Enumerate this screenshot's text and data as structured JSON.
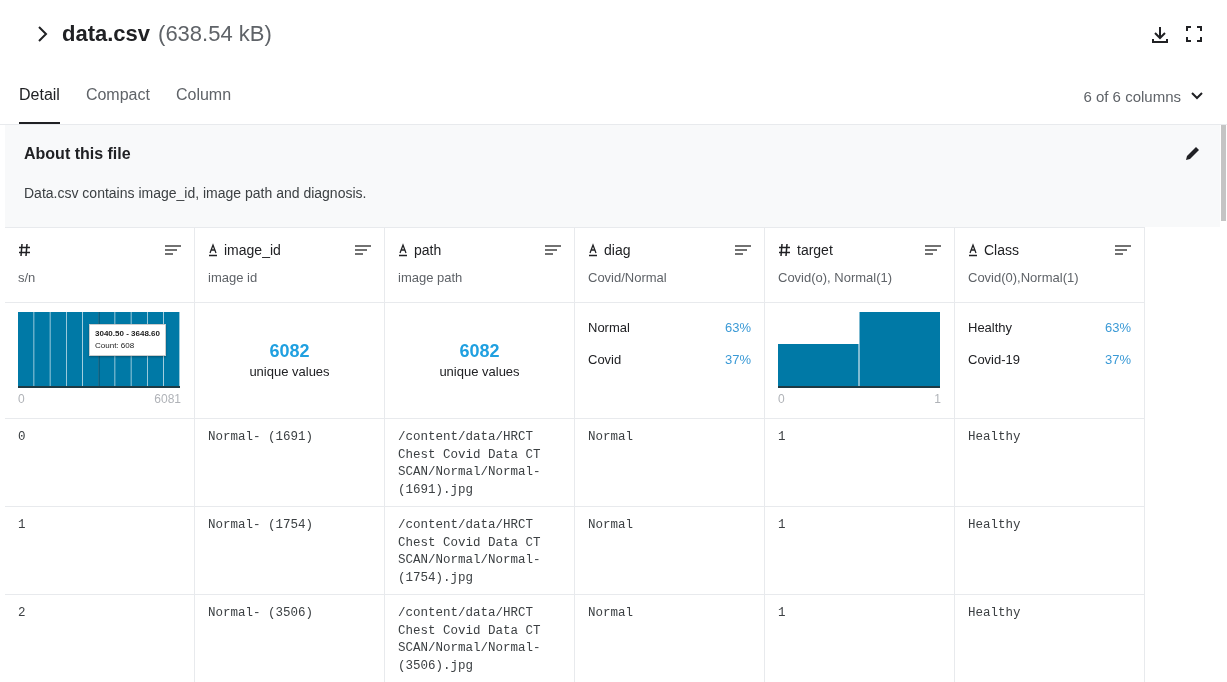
{
  "file": {
    "name": "data.csv",
    "size": "(638.54 kB)"
  },
  "tabs": [
    {
      "label": "Detail",
      "selected": true
    },
    {
      "label": "Compact",
      "selected": false
    },
    {
      "label": "Column",
      "selected": false
    }
  ],
  "columns_selector": "6 of 6 columns",
  "about": {
    "title": "About this file",
    "description": "Data.csv contains image_id, image path and diagnosis."
  },
  "columns": [
    {
      "kind": "number",
      "description": "s/n",
      "summary": {
        "kind": "uniform-histogram",
        "min": "0",
        "max": "6081",
        "tooltip": {
          "range": "3040.50 - 3648.60",
          "count": "Count: 608"
        }
      }
    },
    {
      "kind": "string",
      "name": "image_id",
      "description": "image id",
      "summary": {
        "kind": "unique",
        "count": "6082",
        "label": "unique values"
      }
    },
    {
      "kind": "string",
      "name": "path",
      "description": "image path",
      "summary": {
        "kind": "unique",
        "count": "6082",
        "label": "unique values"
      }
    },
    {
      "kind": "string",
      "name": "diag",
      "description": "Covid/Normal",
      "summary": {
        "kind": "categories",
        "items": [
          {
            "label": "Normal",
            "share": "63%"
          },
          {
            "label": "Covid",
            "share": "37%"
          }
        ]
      }
    },
    {
      "kind": "number",
      "name": "target",
      "description": "Covid(o), Normal(1)",
      "summary": {
        "kind": "binary-histogram",
        "min": "0",
        "max": "1"
      }
    },
    {
      "kind": "string",
      "name": "Class",
      "description": "Covid(0),Normal(1)",
      "summary": {
        "kind": "categories",
        "items": [
          {
            "label": "Healthy",
            "share": "63%"
          },
          {
            "label": "Covid-19",
            "share": "37%"
          }
        ]
      }
    }
  ],
  "rows": [
    [
      "0",
      "Normal- (1691)",
      "/content/data/HRCT Chest Covid Data CT SCAN/Normal/Normal- (1691).jpg",
      "Normal",
      "1",
      "Healthy"
    ],
    [
      "1",
      "Normal- (1754)",
      "/content/data/HRCT Chest Covid Data CT SCAN/Normal/Normal- (1754).jpg",
      "Normal",
      "1",
      "Healthy"
    ],
    [
      "2",
      "Normal- (3506)",
      "/content/data/HRCT Chest Covid Data CT SCAN/Normal/Normal- (3506).jpg",
      "Normal",
      "1",
      "Healthy"
    ]
  ]
}
